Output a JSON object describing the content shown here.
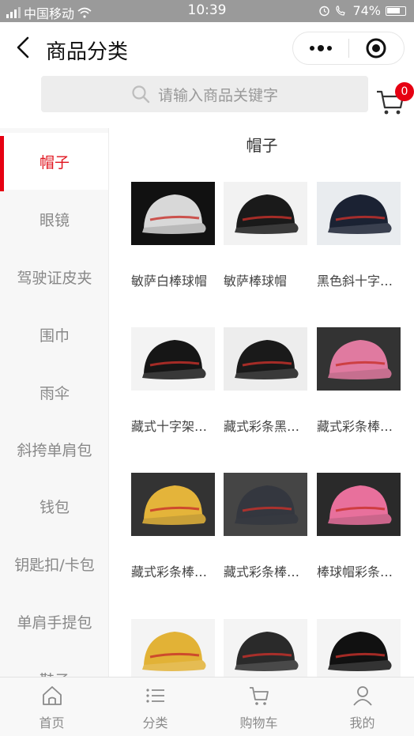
{
  "status_bar": {
    "carrier": "中国移动",
    "time": "10:39",
    "battery": "74%"
  },
  "nav": {
    "title": "商品分类"
  },
  "search": {
    "placeholder": "请输入商品关键字"
  },
  "cart": {
    "badge": "0"
  },
  "sidebar": {
    "items": [
      {
        "label": "帽子"
      },
      {
        "label": "眼镜"
      },
      {
        "label": "驾驶证皮夹"
      },
      {
        "label": "围巾"
      },
      {
        "label": "雨伞"
      },
      {
        "label": "斜挎单肩包"
      },
      {
        "label": "钱包"
      },
      {
        "label": "钥匙扣/卡包"
      },
      {
        "label": "单肩手提包"
      },
      {
        "label": "鞋子"
      }
    ],
    "active": 0
  },
  "content": {
    "title": "帽子",
    "products": [
      {
        "name": "敏萨白棒球帽",
        "color": "#d8d8d8",
        "bg": "#111111"
      },
      {
        "name": "敏萨棒球帽",
        "color": "#1a1a1a",
        "bg": "#f2f2f2"
      },
      {
        "name": "黑色斜十字…",
        "color": "#1b2233",
        "bg": "#e9ecef"
      },
      {
        "name": "藏式十字架…",
        "color": "#161616",
        "bg": "#f3f3f3"
      },
      {
        "name": "藏式彩条黑…",
        "color": "#1a1a1a",
        "bg": "#ededed"
      },
      {
        "name": "藏式彩条棒…",
        "color": "#e07aa0",
        "bg": "#333333"
      },
      {
        "name": "藏式彩条棒…",
        "color": "#e4b43a",
        "bg": "#333333"
      },
      {
        "name": "藏式彩条棒…",
        "color": "#34373f",
        "bg": "#454545"
      },
      {
        "name": "棒球帽彩条…",
        "color": "#e8709c",
        "bg": "#2a2a2a"
      },
      {
        "name": "",
        "color": "#e2b236",
        "bg": "#f4f4f4"
      },
      {
        "name": "",
        "color": "#2a2a2a",
        "bg": "#f4f4f4"
      },
      {
        "name": "",
        "color": "#111111",
        "bg": "#f4f4f4"
      }
    ]
  },
  "tabbar": {
    "items": [
      {
        "label": "首页",
        "icon": "home-icon"
      },
      {
        "label": "分类",
        "icon": "list-icon"
      },
      {
        "label": "购物车",
        "icon": "cart-icon"
      },
      {
        "label": "我的",
        "icon": "user-icon"
      }
    ]
  }
}
